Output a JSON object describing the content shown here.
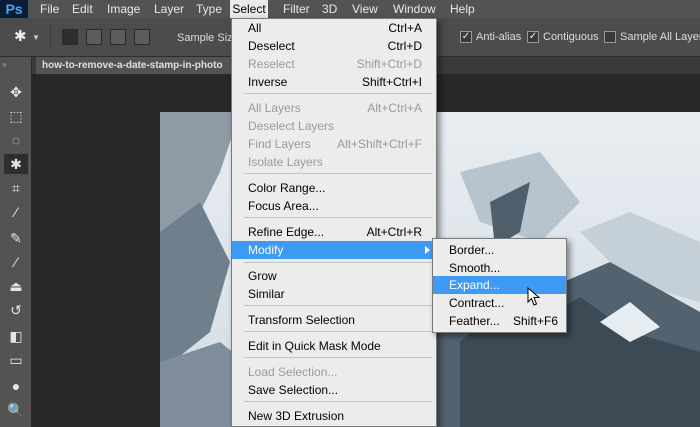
{
  "app": {
    "logo": "Ps"
  },
  "menubar": [
    "File",
    "Edit",
    "Image",
    "Layer",
    "Type",
    "Select",
    "Filter",
    "3D",
    "View",
    "Window",
    "Help"
  ],
  "options_bar": {
    "sample_size_label": "Sample Size:",
    "anti_alias_label": "Anti-alias",
    "contiguous_label": "Contiguous",
    "sample_all_layers_label": "Sample All Layers",
    "anti_alias_checked": true,
    "contiguous_checked": true,
    "sample_all_layers_checked": false
  },
  "document_tab": "how-to-remove-a-date-stamp-in-photo",
  "select_menu": [
    {
      "label": "All",
      "shortcut": "Ctrl+A",
      "disabled": false
    },
    {
      "label": "Deselect",
      "shortcut": "Ctrl+D",
      "disabled": false
    },
    {
      "label": "Reselect",
      "shortcut": "Shift+Ctrl+D",
      "disabled": true
    },
    {
      "label": "Inverse",
      "shortcut": "Shift+Ctrl+I",
      "disabled": false
    },
    {
      "label": "All Layers",
      "shortcut": "Alt+Ctrl+A",
      "disabled": true
    },
    {
      "label": "Deselect Layers",
      "shortcut": "",
      "disabled": true
    },
    {
      "label": "Find Layers",
      "shortcut": "Alt+Shift+Ctrl+F",
      "disabled": true
    },
    {
      "label": "Isolate Layers",
      "shortcut": "",
      "disabled": true
    },
    {
      "label": "Color Range...",
      "shortcut": "",
      "disabled": false
    },
    {
      "label": "Focus Area...",
      "shortcut": "",
      "disabled": false
    },
    {
      "label": "Refine Edge...",
      "shortcut": "Alt+Ctrl+R",
      "disabled": false
    },
    {
      "label": "Modify",
      "shortcut": "",
      "disabled": false
    },
    {
      "label": "Grow",
      "shortcut": "",
      "disabled": false
    },
    {
      "label": "Similar",
      "shortcut": "",
      "disabled": false
    },
    {
      "label": "Transform Selection",
      "shortcut": "",
      "disabled": false
    },
    {
      "label": "Edit in Quick Mask Mode",
      "shortcut": "",
      "disabled": false
    },
    {
      "label": "Load Selection...",
      "shortcut": "",
      "disabled": true
    },
    {
      "label": "Save Selection...",
      "shortcut": "",
      "disabled": false
    },
    {
      "label": "New 3D Extrusion",
      "shortcut": "",
      "disabled": false
    }
  ],
  "modify_submenu": [
    {
      "label": "Border...",
      "shortcut": ""
    },
    {
      "label": "Smooth...",
      "shortcut": ""
    },
    {
      "label": "Expand...",
      "shortcut": ""
    },
    {
      "label": "Contract...",
      "shortcut": ""
    },
    {
      "label": "Feather...",
      "shortcut": "Shift+F6"
    }
  ],
  "tools": [
    "move-icon",
    "marquee-icon",
    "lasso-icon",
    "magic-wand-icon",
    "crop-icon",
    "eyedropper-icon",
    "healing-brush-icon",
    "brush-icon",
    "clone-stamp-icon",
    "history-brush-icon",
    "eraser-icon",
    "gradient-icon",
    "blur-icon",
    "dodge-icon"
  ],
  "colors": {
    "menu_highlight": "#3f9af5",
    "menubar": "#535353",
    "app_bg": "#282828"
  }
}
